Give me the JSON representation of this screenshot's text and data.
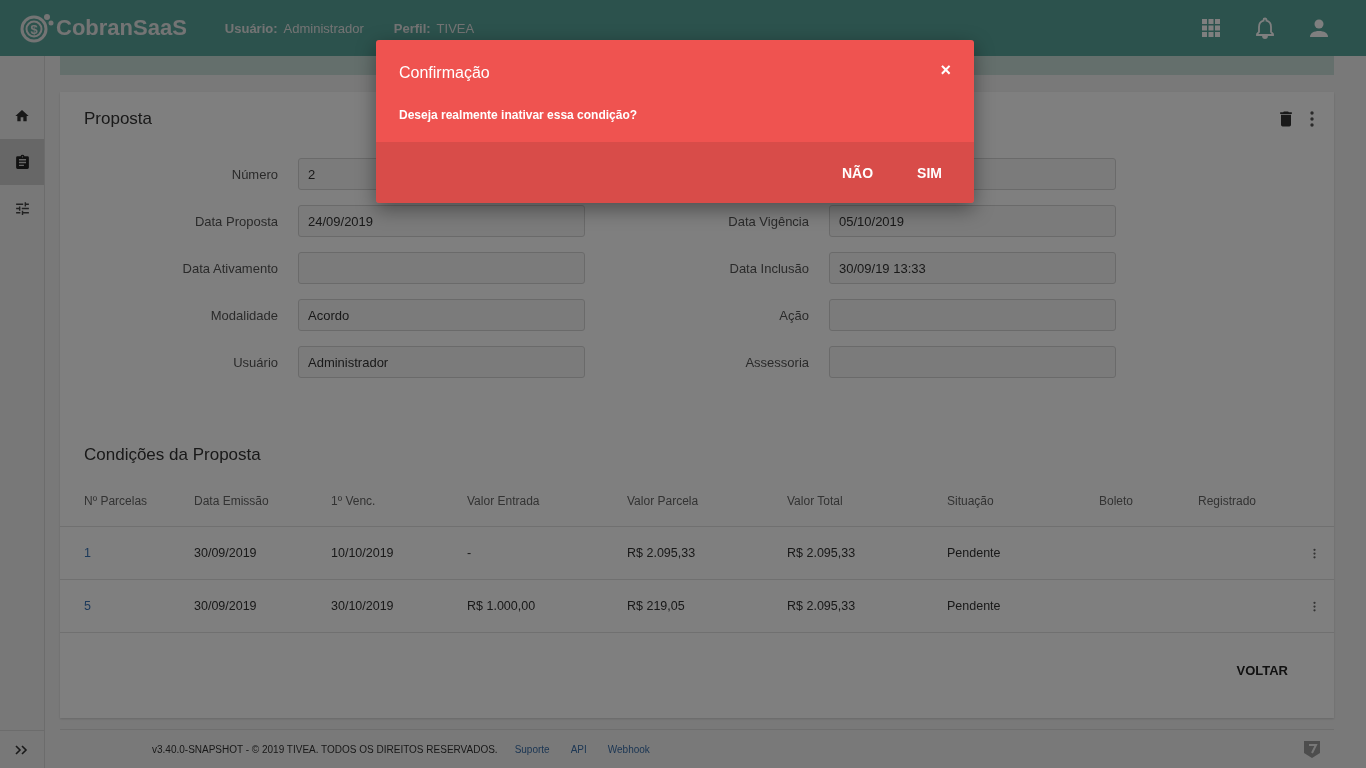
{
  "header": {
    "logo_symbol": "$",
    "brand": "CobranSaaS",
    "user_label": "Usuário:",
    "user_value": "Administrador",
    "profile_label": "Perfil:",
    "profile_value": "TIVEA"
  },
  "sidebar": {
    "items": [
      {
        "selected": false
      },
      {
        "selected": true
      },
      {
        "selected": false
      }
    ]
  },
  "card": {
    "title": "Proposta",
    "form_rows": [
      {
        "left": {
          "label": "Número",
          "value": "2"
        },
        "right": {}
      },
      {
        "left": {
          "label": "Data Proposta",
          "value": "24/09/2019"
        },
        "right": {
          "label": "Data Vigência",
          "value": "05/10/2019"
        }
      },
      {
        "left": {
          "label": "Data Ativamento"
        },
        "right": {
          "label": "Data Inclusão",
          "value": "30/09/19 13:33"
        }
      },
      {
        "left": {
          "label": "Modalidade",
          "value": "Acordo"
        },
        "right": {
          "label": "Ação"
        }
      },
      {
        "left": {
          "label": "Usuário",
          "value": "Administrador"
        },
        "right": {
          "label": "Assessoria"
        }
      }
    ],
    "conditions_title": "Condições da Proposta",
    "table": {
      "columns": [
        "Nº Parcelas",
        "Data Emissão",
        "1º Venc.",
        "Valor Entrada",
        "Valor Parcela",
        "Valor Total",
        "Situação",
        "Boleto",
        "Registrado"
      ],
      "rows": [
        [
          "1",
          "30/09/2019",
          "10/10/2019",
          "-",
          "R$ 2.095,33",
          "R$ 2.095,33",
          "Pendente",
          "",
          ""
        ],
        [
          "5",
          "30/09/2019",
          "30/10/2019",
          "R$ 1.000,00",
          "R$ 219,05",
          "R$ 2.095,33",
          "Pendente",
          "",
          ""
        ]
      ]
    },
    "back_button": "VOLTAR"
  },
  "footer": {
    "text": "v3.40.0-SNAPSHOT - © 2019 TIVEA. TODOS OS DIREITOS RESERVADOS.",
    "links": [
      "Suporte",
      "API",
      "Webhook"
    ]
  },
  "dialog": {
    "title": "Confirmação",
    "close": "×",
    "message": "Deseja realmente inativar essa condição?",
    "buttons": [
      "NÃO",
      "SIM"
    ]
  }
}
